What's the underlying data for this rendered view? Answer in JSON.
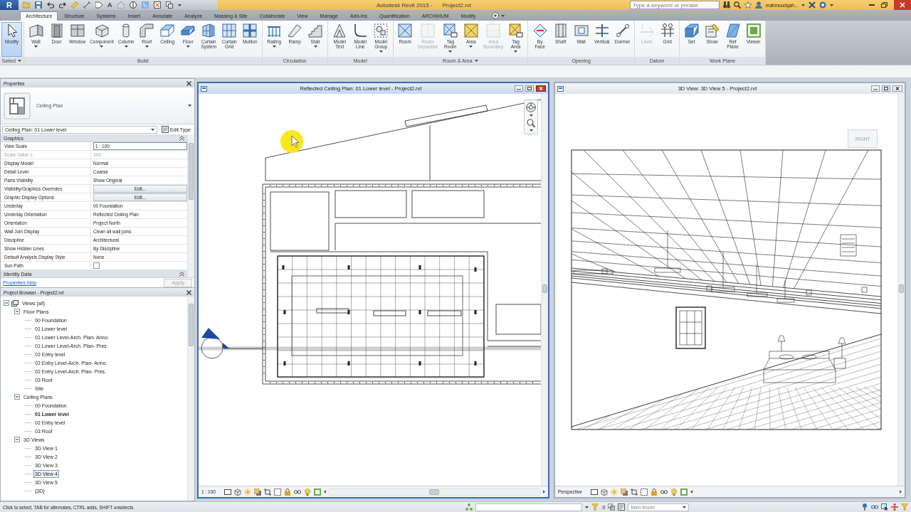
{
  "title_bar": {
    "app_button": "R",
    "text_tool_glyph": "A",
    "app_title": "Autodesk Revit 2015 -",
    "file_name": "Project2.rvt",
    "search": {
      "placeholder": "Type a keyword or phrase"
    },
    "user": "mahmoudqah..."
  },
  "tabs": [
    {
      "label": "Architecture",
      "selected": true
    },
    {
      "label": "Structure",
      "selected": false
    },
    {
      "label": "Systems",
      "selected": false
    },
    {
      "label": "Insert",
      "selected": false
    },
    {
      "label": "Annotate",
      "selected": false
    },
    {
      "label": "Analyze",
      "selected": false
    },
    {
      "label": "Massing & Site",
      "selected": false
    },
    {
      "label": "Collaborate",
      "selected": false
    },
    {
      "label": "View",
      "selected": false
    },
    {
      "label": "Manage",
      "selected": false
    },
    {
      "label": "Add-Ins",
      "selected": false
    },
    {
      "label": "Quantification",
      "selected": false
    },
    {
      "label": "ARCHIHUM",
      "selected": false
    },
    {
      "label": "Modify",
      "selected": false
    }
  ],
  "ribbon": [
    {
      "label": "Select",
      "dropdown": true,
      "buttons": [
        {
          "label": "Modify",
          "selected": true,
          "disabled": false,
          "dropdown": false
        }
      ]
    },
    {
      "label": "Build",
      "dropdown": false,
      "buttons": [
        {
          "label": "Wall",
          "selected": false,
          "disabled": false,
          "dropdown": true
        },
        {
          "label": "Door",
          "selected": false,
          "disabled": false,
          "dropdown": false
        },
        {
          "label": "Window",
          "selected": false,
          "disabled": false,
          "dropdown": false
        },
        {
          "label": "Component",
          "selected": false,
          "disabled": false,
          "dropdown": true
        },
        {
          "label": "Column",
          "selected": false,
          "disabled": false,
          "dropdown": true
        },
        {
          "label": "Roof",
          "selected": false,
          "disabled": false,
          "dropdown": true
        },
        {
          "label": "Ceiling",
          "selected": false,
          "disabled": false,
          "dropdown": false
        },
        {
          "label": "Floor",
          "selected": false,
          "disabled": false,
          "dropdown": true
        },
        {
          "label": "Curtain System",
          "selected": false,
          "disabled": false,
          "dropdown": false
        },
        {
          "label": "Curtain Grid",
          "selected": false,
          "disabled": false,
          "dropdown": false
        },
        {
          "label": "Mullion",
          "selected": false,
          "disabled": false,
          "dropdown": false
        }
      ]
    },
    {
      "label": "Circulation",
      "dropdown": false,
      "buttons": [
        {
          "label": "Railing",
          "selected": false,
          "disabled": false,
          "dropdown": true
        },
        {
          "label": "Ramp",
          "selected": false,
          "disabled": false,
          "dropdown": false
        },
        {
          "label": "Stair",
          "selected": false,
          "disabled": false,
          "dropdown": true
        }
      ]
    },
    {
      "label": "Model",
      "dropdown": false,
      "buttons": [
        {
          "label": "Model Text",
          "selected": false,
          "disabled": false,
          "dropdown": false
        },
        {
          "label": "Model Line",
          "selected": false,
          "disabled": false,
          "dropdown": false
        },
        {
          "label": "Model Group",
          "selected": false,
          "disabled": false,
          "dropdown": true
        }
      ]
    },
    {
      "label": "Room & Area",
      "dropdown": true,
      "buttons": [
        {
          "label": "Room",
          "selected": false,
          "disabled": false,
          "dropdown": false
        },
        {
          "label": "Room Separator",
          "selected": false,
          "disabled": true,
          "dropdown": false
        },
        {
          "label": "Tag Room",
          "selected": false,
          "disabled": false,
          "dropdown": true
        },
        {
          "label": "Area",
          "selected": false,
          "disabled": false,
          "dropdown": true
        },
        {
          "label": "Area Boundary",
          "selected": false,
          "disabled": true,
          "dropdown": false
        },
        {
          "label": "Tag Area",
          "selected": false,
          "disabled": false,
          "dropdown": true
        }
      ]
    },
    {
      "label": "Opening",
      "dropdown": false,
      "buttons": [
        {
          "label": "By Face",
          "selected": false,
          "disabled": false,
          "dropdown": false
        },
        {
          "label": "Shaft",
          "selected": false,
          "disabled": false,
          "dropdown": false
        },
        {
          "label": "Wall",
          "selected": false,
          "disabled": false,
          "dropdown": false
        },
        {
          "label": "Vertical",
          "selected": false,
          "disabled": false,
          "dropdown": false
        },
        {
          "label": "Dormer",
          "selected": false,
          "disabled": false,
          "dropdown": false
        }
      ]
    },
    {
      "label": "Datum",
      "dropdown": false,
      "buttons": [
        {
          "label": "Level",
          "selected": false,
          "disabled": true,
          "dropdown": false
        },
        {
          "label": "Grid",
          "selected": false,
          "disabled": false,
          "dropdown": false
        }
      ]
    },
    {
      "label": "Work Plane",
      "dropdown": false,
      "buttons": [
        {
          "label": "Set",
          "selected": false,
          "disabled": false,
          "dropdown": false
        },
        {
          "label": "Show",
          "selected": false,
          "disabled": false,
          "dropdown": false
        },
        {
          "label": "Ref Plane",
          "selected": false,
          "disabled": false,
          "dropdown": false
        },
        {
          "label": "Viewer",
          "selected": false,
          "disabled": false,
          "dropdown": false
        }
      ]
    }
  ],
  "properties": {
    "title": "Properties",
    "type_name": "Ceiling Plan",
    "instance": "Ceiling Plan: 01 Lower level",
    "edit_type": "Edit Type",
    "groups": [
      {
        "label": "Graphics",
        "rows": [
          {
            "kind": "field",
            "name": "View Scale",
            "value": "1 : 100",
            "disabled": false
          },
          {
            "kind": "text",
            "name": "Scale Value 1:",
            "value": "100",
            "disabled": true
          },
          {
            "kind": "text",
            "name": "Display Model",
            "value": "Normal",
            "disabled": false
          },
          {
            "kind": "text",
            "name": "Detail Level",
            "value": "Coarse",
            "disabled": false
          },
          {
            "kind": "text",
            "name": "Parts Visibility",
            "value": "Show Original",
            "disabled": false
          },
          {
            "kind": "button",
            "name": "Visibility/Graphics Overrides",
            "value": "Edit...",
            "disabled": false
          },
          {
            "kind": "button",
            "name": "Graphic Display Options",
            "value": "Edit...",
            "disabled": false
          },
          {
            "kind": "text",
            "name": "Underlay",
            "value": "00 Foundation",
            "disabled": false
          },
          {
            "kind": "text",
            "name": "Underlay Orientation",
            "value": "Reflected Ceiling Plan",
            "disabled": false
          },
          {
            "kind": "text",
            "name": "Orientation",
            "value": "Project North",
            "disabled": false
          },
          {
            "kind": "text",
            "name": "Wall Join Display",
            "value": "Clean all wall joins",
            "disabled": false
          },
          {
            "kind": "text",
            "name": "Discipline",
            "value": "Architectural",
            "disabled": false
          },
          {
            "kind": "text",
            "name": "Show Hidden Lines",
            "value": "By Discipline",
            "disabled": false
          },
          {
            "kind": "text",
            "name": "Default Analysis Display Style",
            "value": "None",
            "disabled": false
          },
          {
            "kind": "checkbox",
            "name": "Sun Path",
            "checked": false,
            "disabled": false
          }
        ]
      },
      {
        "label": "Identity Data"
      }
    ],
    "help_link": "Properties help",
    "apply": {
      "label": "Apply",
      "disabled": true
    }
  },
  "project_browser": {
    "title": "Project Browser - Project2.rvt",
    "tree": [
      {
        "label": "Views (all)",
        "expanded": true,
        "selected": false,
        "children": [
          {
            "label": "Floor Plans",
            "expanded": true,
            "selected": false,
            "children": [
              {
                "label": "00 Foundation",
                "current": false,
                "selected": false
              },
              {
                "label": "01 Lower level",
                "current": false,
                "selected": false
              },
              {
                "label": "01 Lower Level-Arch. Plan- Anno.",
                "current": false,
                "selected": false
              },
              {
                "label": "01 Lower Level-Arch. Plan- Pres.",
                "current": false,
                "selected": false
              },
              {
                "label": "02 Entry level",
                "current": false,
                "selected": false
              },
              {
                "label": "02 Entry Level-Arch. Plan- Anno.",
                "current": false,
                "selected": false
              },
              {
                "label": "02 Entry Level-Arch. Plan- Pres.",
                "current": false,
                "selected": false
              },
              {
                "label": "03 Roof",
                "current": false,
                "selected": false
              },
              {
                "label": "Site",
                "current": false,
                "selected": false
              }
            ]
          },
          {
            "label": "Ceiling Plans",
            "expanded": true,
            "selected": false,
            "children": [
              {
                "label": "00 Foundation",
                "current": false,
                "selected": false
              },
              {
                "label": "01 Lower level",
                "current": true,
                "selected": false
              },
              {
                "label": "02 Entry level",
                "current": false,
                "selected": false
              },
              {
                "label": "03 Roof",
                "current": false,
                "selected": false
              }
            ]
          },
          {
            "label": "3D Views",
            "expanded": true,
            "selected": false,
            "children": [
              {
                "label": "3D View 1",
                "current": false,
                "selected": false
              },
              {
                "label": "3D View 2",
                "current": false,
                "selected": false
              },
              {
                "label": "3D View 3",
                "current": false,
                "selected": false
              },
              {
                "label": "3D View 4",
                "current": false,
                "selected": true
              },
              {
                "label": "3D View 5",
                "current": false,
                "selected": false
              },
              {
                "label": "{3D}",
                "current": false,
                "selected": false
              }
            ]
          }
        ]
      }
    ]
  },
  "views": [
    {
      "kind": "plan",
      "title": "Reflected Ceiling Plan: 01 Lower level - Project2.rvt",
      "active": true,
      "view_scale": "1 : 100"
    },
    {
      "kind": "perspective",
      "title": "3D View: 3D View 5 - Project2.rvt",
      "active": false,
      "view_scale": "Perspective",
      "view_cube": "RIGHT"
    }
  ],
  "status_bar": {
    "message": "Click to select, TAB for alternates, CTRL adds, SHIFT unselects.",
    "selection_count": ":0",
    "model": "Main Model"
  }
}
